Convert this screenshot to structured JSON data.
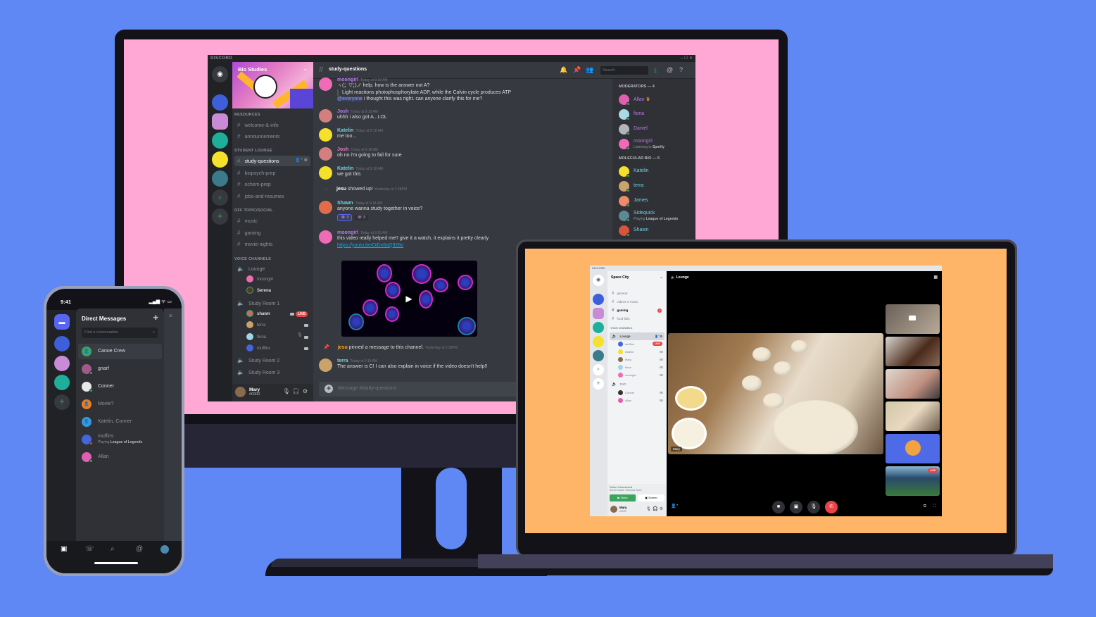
{
  "colors": {
    "background": "#6088f5",
    "monitor_screen": "#ffa8d6",
    "laptop_screen": "#ffb568",
    "blurple": "#5865f2",
    "online": "#3ba55d",
    "live_red": "#ed4245"
  },
  "desktop": {
    "app_title": "DISCORD",
    "window_controls": "–  ☐  ✕",
    "server_name": "Bio Studies",
    "categories": [
      {
        "label": "RESOURCES",
        "channels": [
          "welcome-&-info",
          "announcements"
        ]
      },
      {
        "label": "STUDENT LOUNGE",
        "channels": [
          "study-questions",
          "biopsych-prep",
          "ochem-prep",
          "jobs-and-resumes"
        ]
      },
      {
        "label": "OFF TOPIC/SOCIAL",
        "channels": [
          "music",
          "gaming",
          "movie-nights"
        ]
      },
      {
        "label": "VOICE CHANNELS"
      }
    ],
    "active_channel": "study-questions",
    "voice_channels": [
      {
        "name": "Lounge",
        "users": [
          "moongirl",
          "Serena"
        ]
      },
      {
        "name": "Study Room 1",
        "users": [
          "shawn",
          "terra",
          "fiona",
          "muffins"
        ]
      },
      {
        "name": "Study Room 2"
      },
      {
        "name": "Study Room 3"
      }
    ],
    "live_badge": "LIVE",
    "user": {
      "name": "Mary",
      "tag": "#0000"
    },
    "header": {
      "channel": "study-questions",
      "search_placeholder": "Search"
    },
    "messages": [
      {
        "author": "moongirl",
        "time": "Today at 9:18 AM",
        "lines": [
          "ヽ(；▽；)ノ help. how is the answer not A?",
          "Light reactions photophosphorylate ADP, while the Calvin cycle produces ATP"
        ],
        "mention": "@everyone",
        "mention_text": " i thought this was right. can anyone clarify this for me?"
      },
      {
        "author": "Josh",
        "time": "Today at 9:18 AM",
        "text": "uhhh i also got A...LOL"
      },
      {
        "author": "Katelin",
        "time": "Today at 9:18 AM",
        "text": "me too..."
      },
      {
        "author": "Josh",
        "time": "Today at 9:18 AM",
        "text": "oh no i'm going to fail for sure"
      },
      {
        "author": "Katelin",
        "time": "Today at 9:18 AM",
        "text": "we got this"
      },
      {
        "system": true,
        "actor": "jesu",
        "text": " showed up!",
        "time": "Yesterday at 2:38PM"
      },
      {
        "author": "Shawn",
        "time": "Today at 9:18 AM",
        "text": "anyone wanna study together in voice?",
        "reactions": [
          "3",
          "3"
        ]
      },
      {
        "author": "moongirl",
        "time": "Today at 9:18 AM",
        "text": "this video really helped me!! give it a watch, it explains it pretty clearly",
        "link": "https://youtu.be/OiDx6aQ928o"
      },
      {
        "system": true,
        "actor": "jesu",
        "text": " pinned a message to this channel.",
        "time": "Yesterday at 2:38PM"
      },
      {
        "author": "terra",
        "time": "Today at 9:18 AM",
        "text": "The answer is C! I can also explain in voice if the video doesn't help!!"
      }
    ],
    "compose_placeholder": "Message #study-questions",
    "members": {
      "groups": [
        {
          "label": "MODERATORS — 4",
          "members": [
            {
              "name": "Allan",
              "crown": true
            },
            {
              "name": "fiona"
            },
            {
              "name": "Daniel"
            },
            {
              "name": "moongirl",
              "activity_prefix": "Listening to ",
              "activity": "Spotify"
            }
          ]
        },
        {
          "label": "MOLECULAR BIO — 5",
          "members": [
            {
              "name": "Katelin"
            },
            {
              "name": "terra"
            },
            {
              "name": "James"
            },
            {
              "name": "Sidequick",
              "activity_prefix": "Playing ",
              "activity": "League of Legends"
            },
            {
              "name": "Shawn"
            }
          ]
        }
      ]
    }
  },
  "phone": {
    "time": "9:41",
    "status_icons": "▂▄▆ ᯤ ▭",
    "title": "Direct Messages",
    "search_placeholder": "Find a conversation",
    "dms": [
      {
        "name": "Canoe Crew",
        "group": true,
        "color": "#3ba55d"
      },
      {
        "name": "gnarf"
      },
      {
        "name": "Conner"
      },
      {
        "name": "Movie?",
        "group": true,
        "color": "#e67e22"
      },
      {
        "name": "Katelin, Conner",
        "group": true,
        "color": "#3498db"
      },
      {
        "name": "muffins",
        "activity_prefix": "Playing ",
        "activity": "League of Legends"
      },
      {
        "name": "Allan"
      }
    ],
    "tabs": [
      "home-tab",
      "friends-tab",
      "search-tab",
      "mentions-tab",
      "profile-tab"
    ]
  },
  "laptop": {
    "app_title": "DISCORD",
    "server_name": "Space City",
    "channels": [
      {
        "name": "general"
      },
      {
        "name": "videos-n-music"
      },
      {
        "name": "gaming",
        "unread": true,
        "badge": "1"
      },
      {
        "name": "food-fails"
      }
    ],
    "voice_category": "VOICE CHANNELS",
    "voice_channels": [
      {
        "name": "Lounge",
        "users": [
          "muffins",
          "Katelin",
          "Mary",
          "fiona",
          "moongirl"
        ]
      },
      {
        "name": "DnD",
        "users": [
          "Conner",
          "Allan"
        ]
      }
    ],
    "live_badge": "LIVE",
    "voice_connected": "Voice Connected",
    "voice_server": "Server Name / General Voice",
    "video_button": "Video",
    "screen_button": "Screen",
    "user": {
      "name": "Mary",
      "tag": "#0000"
    },
    "call_header": "Lounge",
    "main_video_label": "Mary"
  }
}
